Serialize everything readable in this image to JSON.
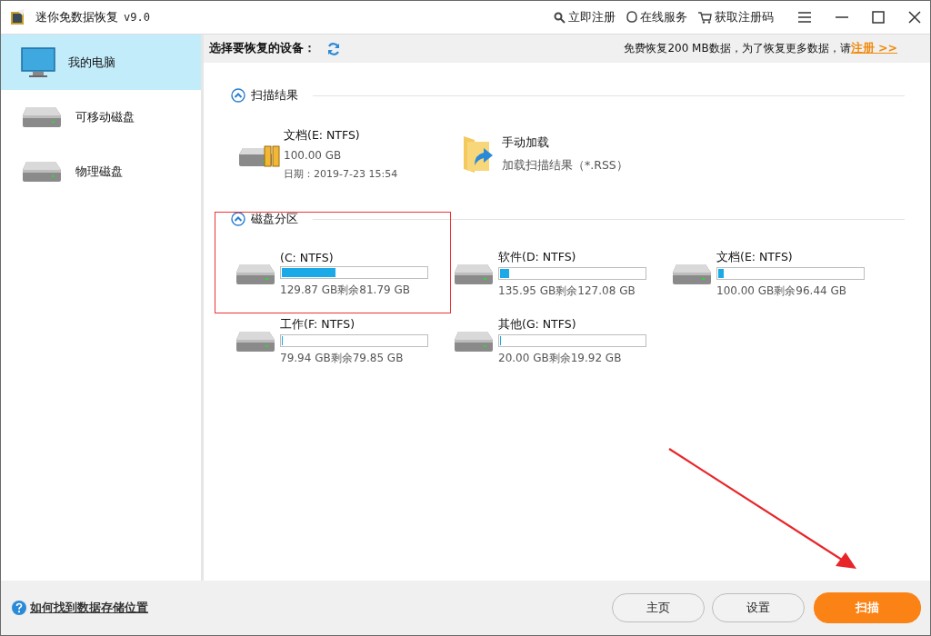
{
  "window": {
    "title": "迷你免数据恢复",
    "version": "v9.0",
    "actions": [
      {
        "kind": "register",
        "label": "立即注册"
      },
      {
        "kind": "service",
        "label": "在线服务"
      },
      {
        "kind": "buy",
        "label": "获取注册码"
      }
    ]
  },
  "sidebar": {
    "items": [
      {
        "kind": "computer",
        "label": "我的电脑",
        "selected": true
      },
      {
        "kind": "removable",
        "label": "可移动磁盘",
        "selected": false
      },
      {
        "kind": "physical",
        "label": "物理磁盘",
        "selected": false
      }
    ]
  },
  "toolbar": {
    "label": "选择要恢复的设备：",
    "notice": "免费恢复200 MB数据，为了恢复更多数据，请",
    "register_link": "注册 >>"
  },
  "scan_results": {
    "title": "扫描结果",
    "expanded": true,
    "items": [
      {
        "kind": "result",
        "name": "文档(E: NTFS)",
        "size": "100.00 GB",
        "date": "日期：2019-7-23 15:54"
      },
      {
        "kind": "load",
        "name": "手动加载",
        "detail": "加载扫描结果（*.RSS）"
      }
    ]
  },
  "partitions": {
    "title": "磁盘分区",
    "expanded": true,
    "items": [
      {
        "name": "(C: NTFS)",
        "level": 0.37,
        "info": "129.87 GB剩余81.79 GB"
      },
      {
        "name": "软件(D: NTFS)",
        "level": 0.065,
        "info": "135.95 GB剩余127.08 GB"
      },
      {
        "name": "文档(E: NTFS)",
        "level": 0.036,
        "info": "100.00 GB剩余96.44 GB"
      },
      {
        "name": "工作(F: NTFS)",
        "level": 0.001,
        "info": "79.94 GB剩余79.85 GB"
      },
      {
        "name": "其他(G: NTFS)",
        "level": 0.004,
        "info": "20.00 GB剩余19.92 GB"
      }
    ]
  },
  "footer": {
    "help_link": "如何找到数据存储位置",
    "buttons": [
      {
        "kind": "secondary",
        "label": "主页"
      },
      {
        "kind": "secondary",
        "label": "设置"
      },
      {
        "kind": "primary",
        "label": "扫描"
      }
    ]
  }
}
